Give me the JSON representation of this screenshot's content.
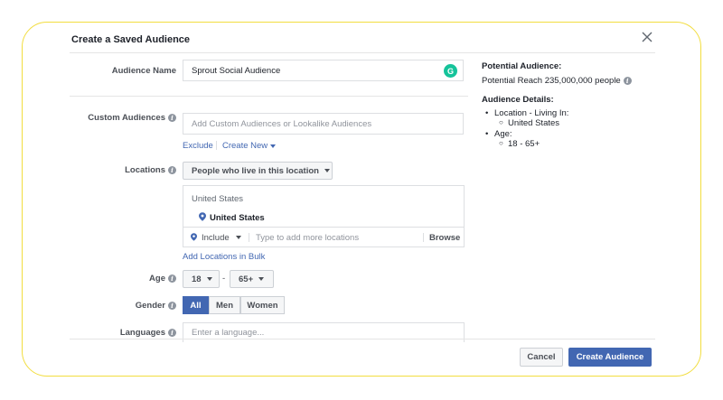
{
  "dialog": {
    "title": "Create a Saved Audience"
  },
  "form": {
    "audience_name": {
      "label": "Audience Name",
      "value": "Sprout Social Audience"
    },
    "custom_audiences": {
      "label": "Custom Audiences",
      "placeholder": "Add Custom Audiences or Lookalike Audiences",
      "exclude_label": "Exclude",
      "create_new_label": "Create New"
    },
    "locations": {
      "label": "Locations",
      "mode": "People who live in this location",
      "group_header": "United States",
      "selected": "United States",
      "include_label": "Include",
      "search_placeholder": "Type to add more locations",
      "browse_label": "Browse",
      "bulk_link": "Add Locations in Bulk"
    },
    "age": {
      "label": "Age",
      "min": "18",
      "dash": "-",
      "max": "65+"
    },
    "gender": {
      "label": "Gender",
      "options": [
        "All",
        "Men",
        "Women"
      ],
      "selected": "All"
    },
    "languages": {
      "label": "Languages",
      "placeholder": "Enter a language..."
    }
  },
  "summary": {
    "potential_title": "Potential Audience:",
    "potential_reach": "Potential Reach 235,000,000 people",
    "details_title": "Audience Details:",
    "location_item": "Location - Living In:",
    "location_value": "United States",
    "age_item": "Age:",
    "age_value": "18 - 65+"
  },
  "footer": {
    "cancel_label": "Cancel",
    "create_label": "Create Audience"
  },
  "colors": {
    "accent": "#4267b2",
    "frame_border": "#f2dd3f",
    "grammarly": "#15c39a"
  }
}
